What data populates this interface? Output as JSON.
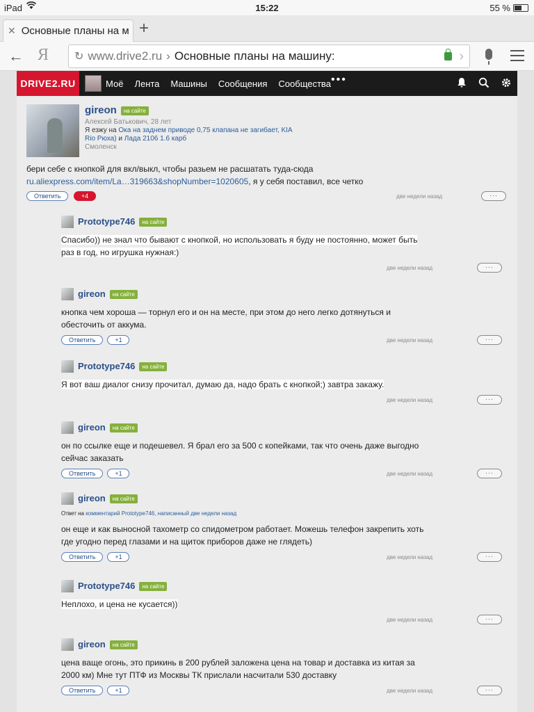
{
  "status": {
    "device": "iPad",
    "time": "15:22",
    "battery": "55 %",
    "battery_level": 0.55
  },
  "browser": {
    "tab_title": "Основные планы на ма",
    "new_tab": "+",
    "back": "←",
    "yandex": "Я",
    "host": "www.drive2.ru",
    "sep": "›",
    "page_title": "Основные планы на машину:"
  },
  "site": {
    "logo": "DRIVE2.RU",
    "nav": [
      "Моё",
      "Лента",
      "Машины",
      "Сообщения",
      "Сообщества"
    ],
    "more": "•••"
  },
  "main": {
    "author": "gireon",
    "badge": "на сайте",
    "name_age": "Алексей Батькович, 28 лет",
    "rides_prefix": "Я езжу на",
    "car1": "Ока на заднем приводе 0,75 клапана не загибает, KIA Rio Рюха)",
    "and": "и",
    "car2": "Лада 2106 1.6 карб",
    "city": "Смоленск",
    "text1": "бери себе с кнопкой для вкл/выкл, чтобы разьем не расшатать туда-сюда",
    "link": "ru.aliexpress.com/item/La…319663&shopNumber=1020605",
    "text2": ", я у себя поставил, все четко",
    "reply_btn": "Ответить",
    "plus": "+4",
    "when": "две недели назад",
    "more": "···"
  },
  "replies": [
    {
      "author": "Prototype746",
      "badge": "на сайте",
      "lines": [
        "Спасибо)) не знал что бывают с кнопкой, но использовать я буду не постоянно, может быть",
        "раз в год, но игрушка нужная:)"
      ],
      "has_buttons": false,
      "when": "две недели назад",
      "more": "···"
    },
    {
      "author": "gireon",
      "badge": "на сайте",
      "lines": [
        "кнопка чем хороша — торнул его и он на месте, при этом до него легко дотянуться и",
        "обесточить от аккума."
      ],
      "has_buttons": true,
      "reply_btn": "Ответить",
      "plus": "+1",
      "when": "две недели назад",
      "more": "···"
    },
    {
      "author": "Prototype746",
      "badge": "на сайте",
      "lines": [
        "Я вот ваш диалог снизу прочитал, думаю да, надо брать с кнопкой;) завтра закажу."
      ],
      "has_buttons": false,
      "when": "две недели назад",
      "more": "···"
    },
    {
      "author": "gireon",
      "badge": "на сайте",
      "lines": [
        "он по ссылке еще и подешевел. Я брал его за 500 с копейками, так что очень даже выгодно",
        "сейчас заказать"
      ],
      "has_buttons": true,
      "reply_btn": "Ответить",
      "plus": "+1",
      "when": "две недели назад",
      "more": "···"
    },
    {
      "author": "gireon",
      "badge": "на сайте",
      "reply_to_prefix": "Ответ на",
      "reply_to_link": "комментарий Prototype746, написанный две недели назад",
      "lines": [
        "он еще и как выносной тахометр со спидометром работает. Можешь телефон закрепить хоть",
        "где угодно перед глазами и на щиток приборов даже не глядеть)"
      ],
      "has_buttons": true,
      "reply_btn": "Ответить",
      "plus": "+1",
      "when": "две недели назад",
      "more": "···"
    },
    {
      "author": "Prototype746",
      "badge": "на сайте",
      "lines": [
        "Неплохо, и цена не кусается))"
      ],
      "has_buttons": false,
      "when": "две недели назад",
      "more": "···"
    },
    {
      "author": "gireon",
      "badge": "на сайте",
      "lines": [
        "цена ваще огонь, это прикинь в 200 рублей заложена цена на товар и доставка из китая за",
        "2000 км) Мне тут ПТФ из Москвы ТК прислали насчитали 530 доставку"
      ],
      "has_buttons": true,
      "reply_btn": "Ответить",
      "plus": "+1",
      "when": "две недели назад",
      "more": "···"
    }
  ]
}
